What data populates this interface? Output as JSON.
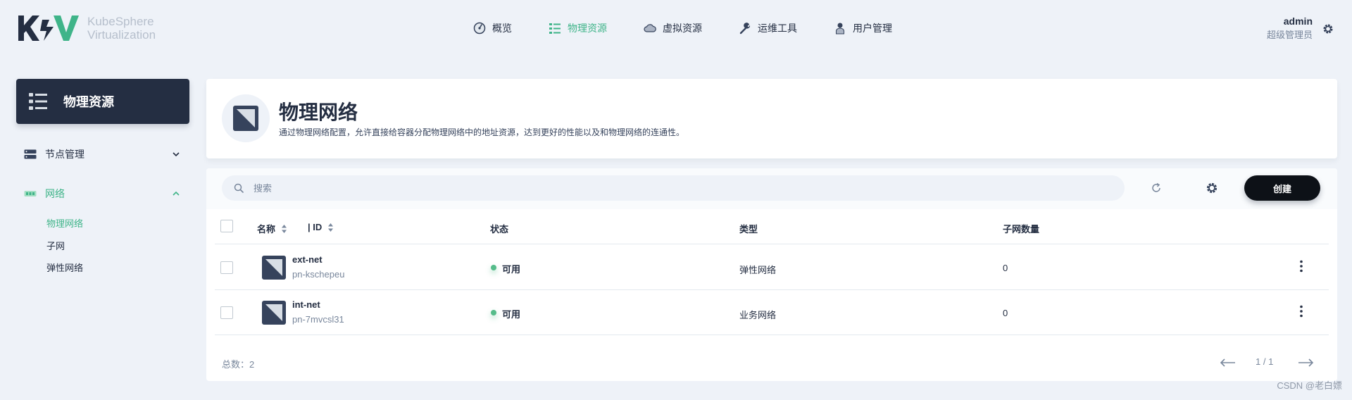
{
  "app": {
    "logo_text_line1": "KubeSphere",
    "logo_text_line2": "Virtualization",
    "brand_color": "#3fb489"
  },
  "nav": {
    "items": [
      {
        "label": "概览",
        "icon": "dashboard-icon"
      },
      {
        "label": "物理资源",
        "icon": "list-icon",
        "active": true
      },
      {
        "label": "虚拟资源",
        "icon": "cloud-icon"
      },
      {
        "label": "运维工具",
        "icon": "wrench-icon"
      },
      {
        "label": "用户管理",
        "icon": "user-icon"
      }
    ]
  },
  "user": {
    "name": "admin",
    "role": "超级管理员"
  },
  "sidebar": {
    "title": "物理资源",
    "menus": [
      {
        "label": "节点管理",
        "icon": "server-icon",
        "expanded": false
      },
      {
        "label": "网络",
        "icon": "network-icon",
        "expanded": true,
        "children": [
          {
            "label": "物理网络",
            "active": true
          },
          {
            "label": "子网"
          },
          {
            "label": "弹性网络"
          }
        ]
      }
    ]
  },
  "banner": {
    "title": "物理网络",
    "description": "通过物理网络配置，允许直接给容器分配物理网络中的地址资源，达到更好的性能以及和物理网络的连通性。"
  },
  "toolbar": {
    "search_placeholder": "搜索",
    "create_label": "创建"
  },
  "table": {
    "columns": {
      "name": "名称",
      "id": "| ID",
      "status": "状态",
      "type": "类型",
      "subnet_count": "子网数量"
    },
    "rows": [
      {
        "name": "ext-net",
        "id": "pn-kschepeu",
        "status": "可用",
        "type": "弹性网络",
        "subnet_count": "0"
      },
      {
        "name": "int-net",
        "id": "pn-7mvcsl31",
        "status": "可用",
        "type": "业务网络",
        "subnet_count": "0"
      }
    ]
  },
  "footer": {
    "total": "总数：2",
    "pagination": "1 / 1"
  },
  "watermark": "CSDN @老白嫖",
  "colors": {
    "status_available": "#55bc8a",
    "dark": "#242e42",
    "muted": "#79879c"
  }
}
